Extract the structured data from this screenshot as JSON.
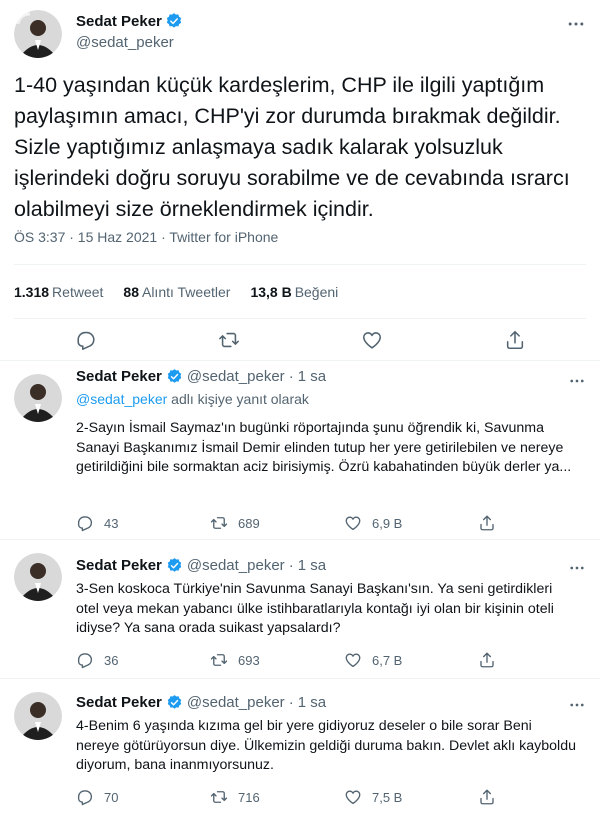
{
  "main_tweet": {
    "author_name": "Sedat Peker",
    "author_handle": "@sedat_peker",
    "text": "1-40 yaşından küçük kardeşlerim, CHP ile ilgili yaptığım paylaşımın amacı, CHP'yi zor durumda bırakmak değildir. Sizle yaptığımız anlaşmaya sadık kalarak yolsuzluk işlerindeki doğru soruyu sorabilme ve de cevabında ısrarcı olabilmeyi size örneklendirmek içindir.",
    "meta": "ÖS 3:37 · 15 Haz 2021 · Twitter for iPhone",
    "stats": {
      "retweet_count": "1.318",
      "retweet_label": "Retweet",
      "quote_count": "88",
      "quote_label": "Alıntı Tweetler",
      "like_count": "13,8 B",
      "like_label": "Beğeni"
    },
    "icons": [
      "reply-icon",
      "retweet-icon",
      "like-icon",
      "share-icon"
    ]
  },
  "replies": [
    {
      "author_name": "Sedat Peker",
      "author_handle": "@sedat_peker",
      "separator": "·",
      "time": "1 sa",
      "reply_to_handle": "@sedat_peker",
      "reply_to_suffix": " adlı kişiye yanıt olarak",
      "text": "2-Sayın İsmail Saymaz'ın bugünki röportajında şunu öğrendik ki, Savunma Sanayi Başkanımız İsmail Demir elinden tutup her yere getirilebilen ve nereye getirildiğini bile sormaktan aciz birisiymiş. Özrü kabahatinden büyük derler ya...",
      "replies": "43",
      "retweets": "689",
      "likes": "6,9 B"
    },
    {
      "author_name": "Sedat Peker",
      "author_handle": "@sedat_peker",
      "separator": "·",
      "time": "1 sa",
      "text": "3-Sen koskoca Türkiye'nin Savunma Sanayi Başkanı'sın. Ya seni getirdikleri otel veya mekan yabancı ülke istihbaratlarıyla kontağı iyi olan bir kişinin oteli idiyse? Ya sana orada suikast yapsalardı?",
      "replies": "36",
      "retweets": "693",
      "likes": "6,7 B"
    },
    {
      "author_name": "Sedat Peker",
      "author_handle": "@sedat_peker",
      "separator": "·",
      "time": "1 sa",
      "text": "4-Benim 6 yaşında kızıma gel bir yere gidiyoruz deseler o bile sorar Beni nereye götürüyorsun diye. Ülkemizin geldiği duruma bakın. Devlet aklı kayboldu diyorum, bana inanmıyorsunuz.",
      "replies": "70",
      "retweets": "716",
      "likes": "7,5 B"
    }
  ],
  "colors": {
    "accent": "#1d9bf0",
    "text": "#0f1419",
    "secondary": "#536471",
    "divider": "#eff3f4"
  }
}
